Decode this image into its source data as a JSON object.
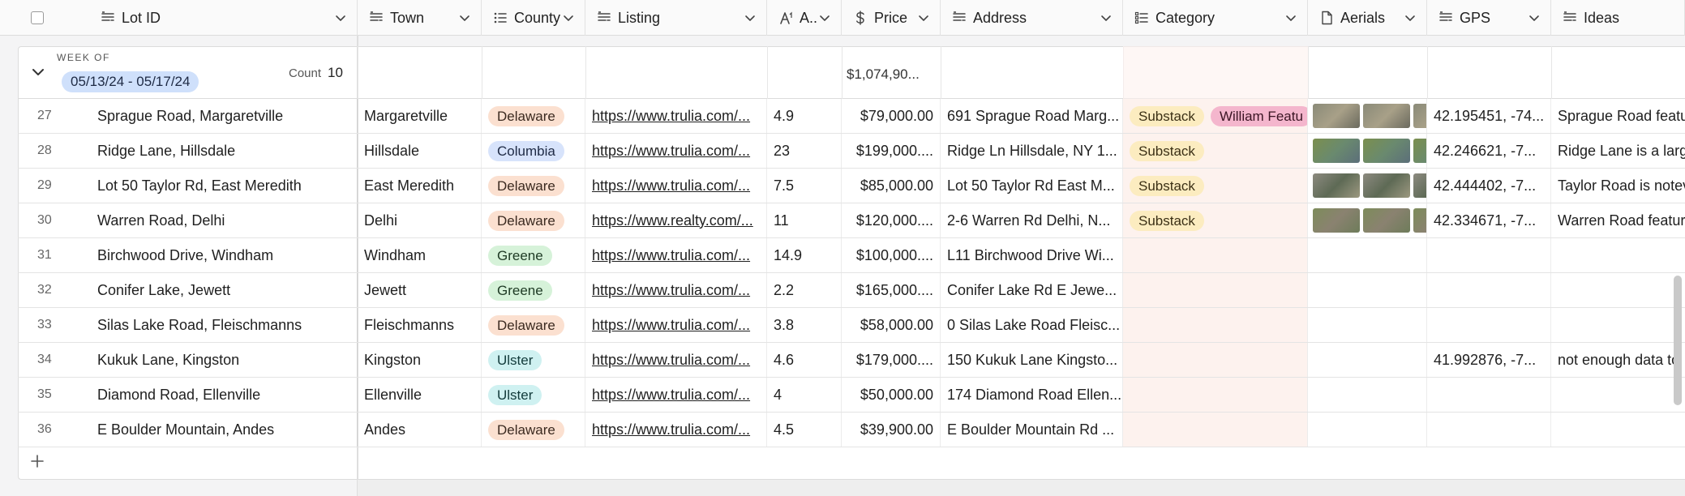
{
  "columns": [
    {
      "key": "lot_id",
      "label": "Lot ID",
      "icon": "long-text-icon"
    },
    {
      "key": "town",
      "label": "Town",
      "icon": "long-text-icon"
    },
    {
      "key": "county",
      "label": "County",
      "icon": "single-select-icon"
    },
    {
      "key": "listing",
      "label": "Listing",
      "icon": "long-text-icon"
    },
    {
      "key": "acres",
      "label": "A...",
      "icon": "number-icon"
    },
    {
      "key": "price",
      "label": "Price",
      "icon": "currency-icon"
    },
    {
      "key": "address",
      "label": "Address",
      "icon": "long-text-icon"
    },
    {
      "key": "category",
      "label": "Category",
      "icon": "multi-select-icon"
    },
    {
      "key": "aerials",
      "label": "Aerials",
      "icon": "attachment-icon"
    },
    {
      "key": "gps",
      "label": "GPS",
      "icon": "long-text-icon"
    },
    {
      "key": "ideas",
      "label": "Ideas",
      "icon": "long-text-icon"
    }
  ],
  "group": {
    "heading": "WEEK OF",
    "range": "05/13/24 - 05/17/24",
    "count_label": "Count",
    "count_value": "10",
    "price_sum": "$1,074,90..."
  },
  "rows": [
    {
      "num": "27",
      "lot_id": "Sprague Road, Margaretville",
      "town": "Margaretville",
      "county": "Delaware",
      "listing": "https://www.trulia.com/...",
      "acres": "4.9",
      "price": "$79,000.00",
      "address": "691 Sprague Road Marg...",
      "category": [
        "Substack",
        "William Featu"
      ],
      "aerials": 3,
      "gps": "42.195451, -74...",
      "ideas": "Sprague Road featu"
    },
    {
      "num": "28",
      "lot_id": "Ridge Lane, Hillsdale",
      "town": "Hillsdale",
      "county": "Columbia",
      "listing": "https://www.trulia.com/...",
      "acres": "23",
      "price": "$199,000....",
      "address": "Ridge Ln Hillsdale, NY 1...",
      "category": [
        "Substack"
      ],
      "aerials": 3,
      "gps": "42.246621, -7...",
      "ideas": "Ridge Lane is a larg"
    },
    {
      "num": "29",
      "lot_id": "Lot 50 Taylor Rd, East Meredith",
      "town": "East Meredith",
      "county": "Delaware",
      "listing": "https://www.trulia.com/...",
      "acres": "7.5",
      "price": "$85,000.00",
      "address": "Lot 50 Taylor Rd East M...",
      "category": [
        "Substack"
      ],
      "aerials": 3,
      "gps": "42.444402, -7...",
      "ideas": "Taylor Road is notev"
    },
    {
      "num": "30",
      "lot_id": "Warren Road, Delhi",
      "town": "Delhi",
      "county": "Delaware",
      "listing": "https://www.realty.com/...",
      "acres": "11",
      "price": "$120,000....",
      "address": "2-6 Warren Rd Delhi, N...",
      "category": [
        "Substack"
      ],
      "aerials": 3,
      "gps": "42.334671, -7...",
      "ideas": "Warren Road featur"
    },
    {
      "num": "31",
      "lot_id": "Birchwood Drive, Windham",
      "town": "Windham",
      "county": "Greene",
      "listing": "https://www.trulia.com/...",
      "acres": "14.9",
      "price": "$100,000....",
      "address": "L11 Birchwood Drive Wi...",
      "category": [],
      "aerials": 0,
      "gps": "",
      "ideas": ""
    },
    {
      "num": "32",
      "lot_id": "Conifer Lake, Jewett",
      "town": "Jewett",
      "county": "Greene",
      "listing": "https://www.trulia.com/...",
      "acres": "2.2",
      "price": "$165,000....",
      "address": "Conifer Lake Rd E Jewe...",
      "category": [],
      "aerials": 0,
      "gps": "",
      "ideas": ""
    },
    {
      "num": "33",
      "lot_id": "Silas Lake Road, Fleischmanns",
      "town": "Fleischmanns",
      "county": "Delaware",
      "listing": "https://www.trulia.com/...",
      "acres": "3.8",
      "price": "$58,000.00",
      "address": "0 Silas Lake Road Fleisc...",
      "category": [],
      "aerials": 0,
      "gps": "",
      "ideas": ""
    },
    {
      "num": "34",
      "lot_id": "Kukuk Lane, Kingston",
      "town": "Kingston",
      "county": "Ulster",
      "listing": "https://www.trulia.com/...",
      "acres": "4.6",
      "price": "$179,000....",
      "address": "150 Kukuk Lane Kingsto...",
      "category": [],
      "aerials": 0,
      "gps": "41.992876, -7...",
      "ideas": "not enough data to"
    },
    {
      "num": "35",
      "lot_id": "Diamond Road, Ellenville",
      "town": "Ellenville",
      "county": "Ulster",
      "listing": "https://www.trulia.com/...",
      "acres": "4",
      "price": "$50,000.00",
      "address": "174 Diamond Road Ellen...",
      "category": [],
      "aerials": 0,
      "gps": "",
      "ideas": ""
    },
    {
      "num": "36",
      "lot_id": "E Boulder Mountain, Andes",
      "town": "Andes",
      "county": "Delaware",
      "listing": "https://www.trulia.com/...",
      "acres": "4.5",
      "price": "$39,900.00",
      "address": "E Boulder Mountain Rd ...",
      "category": [],
      "aerials": 0,
      "gps": "",
      "ideas": ""
    }
  ],
  "colors": {
    "Delaware": "#fbe0d0",
    "Columbia": "#d7e3fb",
    "Greene": "#d6f2d9",
    "Ulster": "#cff1f1",
    "Substack": "#fcecc0",
    "William Featu": "#f4b6cd",
    "week_pill": "#cfe0fb",
    "category_column_bg": "#fdf2ee"
  }
}
